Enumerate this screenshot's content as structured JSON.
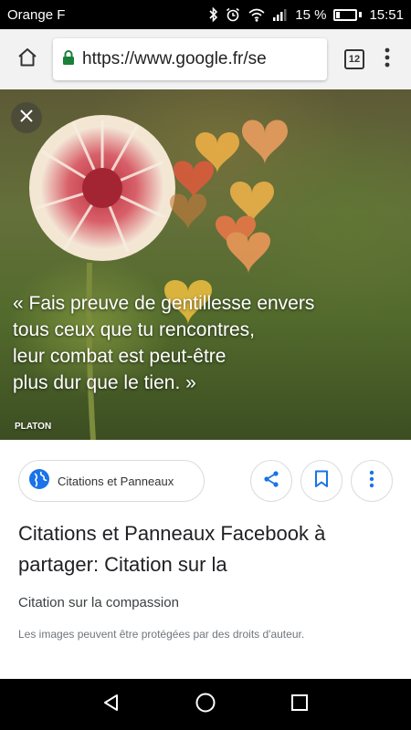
{
  "status_bar": {
    "carrier": "Orange F",
    "battery": "15 %",
    "time": "15:51"
  },
  "browser": {
    "url": "https://www.google.fr/se",
    "tab_count": "12"
  },
  "image": {
    "quote_lines": [
      "« Fais preuve de gentillesse envers",
      "tous ceux que tu rencontres,",
      "leur combat est peut-être",
      "plus dur que le tien. »"
    ],
    "author": "PLATON"
  },
  "info": {
    "source_chip": "Citations et Panneaux",
    "title": "Citations et Panneaux Facebook à partager: Citation sur la",
    "subtitle": "Citation sur la compassion",
    "copyright": "Les images peuvent être protégées par des droits d'auteur."
  },
  "colors": {
    "accent": "#1a73e8",
    "lock": "#188038"
  }
}
